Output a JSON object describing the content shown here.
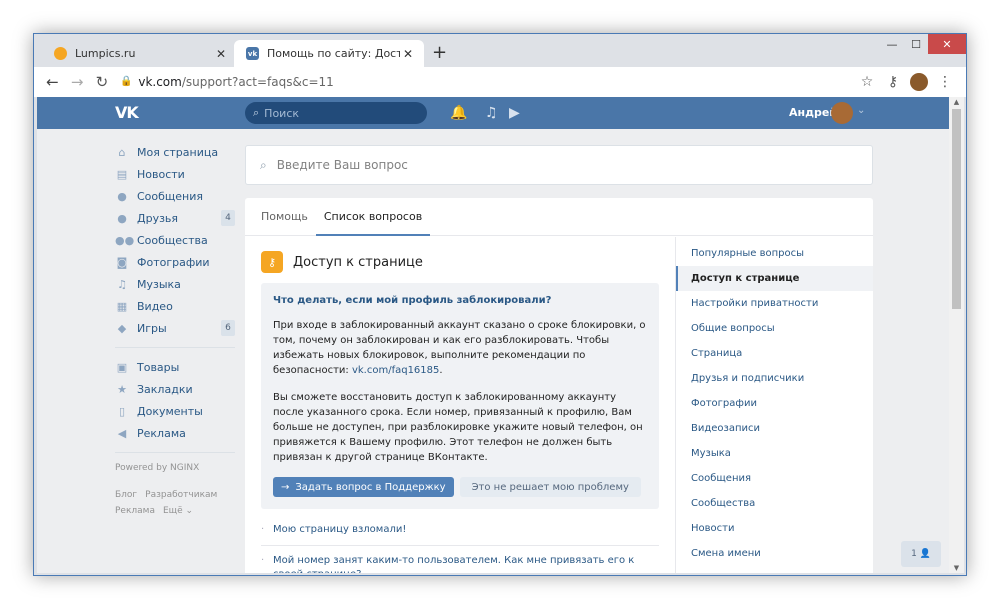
{
  "browser": {
    "tabs": [
      {
        "title": "Lumpics.ru",
        "close": "✕"
      },
      {
        "title": "Помощь по сайту: Доступ к стр",
        "close": "✕"
      }
    ],
    "new_tab": "+",
    "window_controls": {
      "minimize": "—",
      "maximize": "☐",
      "close": "✕"
    },
    "url_host": "vk.com",
    "url_path": "/support?act=faqs&c=11",
    "nav": {
      "back": "←",
      "forward": "→",
      "reload": "↻"
    },
    "icons": {
      "star": "star-icon",
      "key": "key-icon",
      "menu": "menu-icon"
    }
  },
  "vk_header": {
    "logo": "VK",
    "search_placeholder": "Поиск",
    "user_name": "Андрей"
  },
  "left_nav": {
    "items": [
      {
        "label": "Моя страница",
        "icon": "home-icon"
      },
      {
        "label": "Новости",
        "icon": "news-icon"
      },
      {
        "label": "Сообщения",
        "icon": "messages-icon"
      },
      {
        "label": "Друзья",
        "icon": "friends-icon",
        "badge": "4"
      },
      {
        "label": "Сообщества",
        "icon": "groups-icon"
      },
      {
        "label": "Фотографии",
        "icon": "camera-icon"
      },
      {
        "label": "Музыка",
        "icon": "music-icon"
      },
      {
        "label": "Видео",
        "icon": "video-icon"
      },
      {
        "label": "Игры",
        "icon": "games-icon",
        "badge": "6"
      }
    ],
    "items2": [
      {
        "label": "Товары",
        "icon": "bag-icon"
      },
      {
        "label": "Закладки",
        "icon": "star-icon"
      },
      {
        "label": "Документы",
        "icon": "document-icon"
      },
      {
        "label": "Реклама",
        "icon": "megaphone-icon"
      }
    ],
    "powered": "Powered by NGINX",
    "footer": {
      "blog": "Блог",
      "devs": "Разработчикам",
      "ads": "Реклама",
      "more": "Ещё ⌄"
    }
  },
  "question_box": {
    "placeholder": "Введите Ваш вопрос"
  },
  "tabs": {
    "help": "Помощь",
    "questions": "Список вопросов"
  },
  "section": {
    "title": "Доступ к странице",
    "open_question": "Что делать, если мой профиль заблокировали?",
    "paragraph1": "При входе в заблокированный аккаунт сказано о сроке блокировки, о том, почему он заблокирован и как его разблокировать. Чтобы избежать новых блокировок, выполните рекомендации по безопасности: ",
    "paragraph1_link": "vk.com/faq16185",
    "paragraph2": "Вы сможете восстановить доступ к заблокированному аккаунту после указанного срока. Если номер, привязанный к профилю, Вам больше не доступен, при разблокировке укажите новый телефон, он привяжется к Вашему профилю. Этот телефон не должен быть привязан к другой странице ВКонтакте.",
    "btn_support": "Задать вопрос в Поддержку",
    "btn_not_solved": "Это не решает мою проблему",
    "other_questions": [
      "Мою страницу взломали!",
      "Мой номер занят каким-то пользователем. Как мне привязать его к своей странице?"
    ]
  },
  "right_menu": [
    "Популярные вопросы",
    "Доступ к странице",
    "Настройки приватности",
    "Общие вопросы",
    "Страница",
    "Друзья и подписчики",
    "Фотографии",
    "Видеозаписи",
    "Музыка",
    "Сообщения",
    "Сообщества",
    "Новости",
    "Смена имени"
  ],
  "friends_chip": "1 👤"
}
